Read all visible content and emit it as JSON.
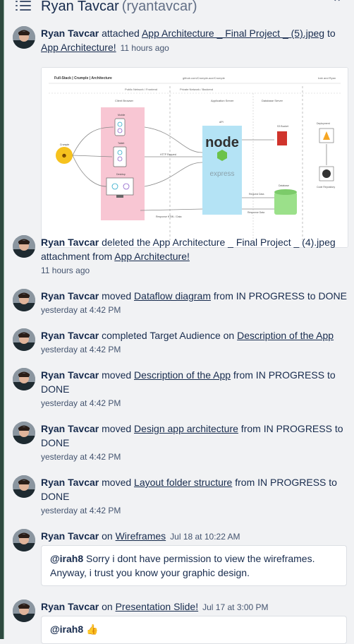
{
  "header": {
    "name": "Ryan Tavcar",
    "handle": "(ryantavcar)",
    "close_icon": "chevron-up-icon",
    "list_icon": "activity-list-icon"
  },
  "activities": [
    {
      "user": "Ryan Tavcar",
      "verb": " attached ",
      "link1": "App Architecture _ Final Project _ (5).jpeg",
      "mid": " to ",
      "link2": "App Architecture!",
      "time": "11 hours ago"
    },
    {
      "user": "Ryan Tavcar",
      "text": " deleted the App Architecture _ Final Project _ (4).jpeg attachment from ",
      "link1": "App Architecture!",
      "time": "11 hours ago"
    },
    {
      "user": "Ryan Tavcar",
      "verb": " moved ",
      "link1": "Dataflow diagram",
      "rest": " from IN PROGRESS to DONE",
      "time": "yesterday at 4:42 PM"
    },
    {
      "user": "Ryan Tavcar",
      "verb": " completed Target Audience on ",
      "link1": "Description of the App",
      "time": "yesterday at 4:42 PM"
    },
    {
      "user": "Ryan Tavcar",
      "verb": " moved ",
      "link1": "Description of the App",
      "rest": " from IN PROGRESS to DONE",
      "time": "yesterday at 4:42 PM"
    },
    {
      "user": "Ryan Tavcar",
      "verb": " moved ",
      "link1": "Design app architecture",
      "rest": " from IN PROGRESS to DONE",
      "time": "yesterday at 4:42 PM"
    },
    {
      "user": "Ryan Tavcar",
      "verb": " moved ",
      "link1": "Layout folder structure",
      "rest": " from IN PROGRESS to DONE",
      "time": "yesterday at 4:42 PM"
    },
    {
      "user": "Ryan Tavcar",
      "verb": " on ",
      "link1": "Wireframes",
      "time": "Jul 18 at 10:22 AM",
      "comment_mention": "@irah8",
      "comment_text": " Sorry i dont have permission to view the wireframes. Anyway, i trust you know your graphic design."
    },
    {
      "user": "Ryan Tavcar",
      "verb": " on ",
      "link1": "Presentation Slide!",
      "time": "Jul 17 at 3:00 PM",
      "comment_mention": "@irah8",
      "comment_emoji": "👍"
    }
  ],
  "diagram": {
    "title": "Full-Stack | Crumple | Architecture",
    "url": "github.com/Crumple-ace/Crumple",
    "corner": "Irah and Ryan",
    "public_network": "Public Network / Frontend",
    "private_network": "Private Network / Backend",
    "client_browser": "Client Browser",
    "app_server": "Application Server",
    "db_server": "Database Server",
    "user_label": "Crumple",
    "mobile": "Mobile",
    "tablet": "Tablet",
    "desktop": "Desktop",
    "http_request": "HTTP Request",
    "response": "Response HTML / Data",
    "api": "API",
    "node": "node",
    "express": "express",
    "request_data": "Request Data",
    "response_data": "Response Data",
    "s3": "S3 Bucket",
    "database": "Database",
    "deployment": "Deployment",
    "code_repo": "Code Repository",
    "colors": {
      "client_panel": "#f8c6d3",
      "server_panel": "#b4e3f5",
      "db_green": "#9be08a",
      "s3_red": "#d0342c",
      "firebase": "#f6a623"
    }
  }
}
